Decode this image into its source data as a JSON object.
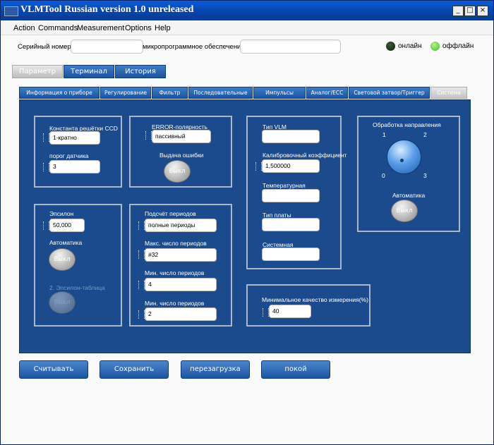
{
  "window": {
    "title": "VLMTool  Russian version 1.0 unreleased",
    "min_glyph": "_",
    "max_glyph": "□",
    "close_glyph": "×"
  },
  "menu": [
    "Action",
    "Commands",
    "Measurement",
    "Options",
    "Help"
  ],
  "topbar": {
    "serial_label": "Серийный номер",
    "serial_value": "",
    "firmware_label": "микропрограммное обеспечение",
    "firmware_value": "",
    "online_label": "онлайн",
    "offline_label": "оффлайн",
    "online_color": "#1a3a1a",
    "offline_color": "#4fd02a"
  },
  "main_tabs": [
    "Параметр",
    "Терминал",
    "История"
  ],
  "sub_tabs": [
    "Информация о приборе",
    "Регулирование",
    "Фильтр",
    "Последовательные",
    "Импульсы",
    "Аналог/ЕСС",
    "Световой затвор/Триггер",
    "Система"
  ],
  "ccd": {
    "grating_label": "Константа решётки CCD",
    "grating_value": "1-кратно",
    "threshold_label": "порог датчика",
    "threshold_value": "3"
  },
  "error": {
    "polarity_label": "ERROR-полярность",
    "polarity_value": "пассивный",
    "output_label": "Выдача ошибки",
    "output_button": "Выкл"
  },
  "vlm": {
    "type_label": "Тип VLM",
    "type_value": "",
    "calib_label": "Калибровочный коэффициент",
    "calib_value": "1,500000",
    "temp_label": "Температурная",
    "temp_value": "",
    "board_label": "Тип платы",
    "board_value": "",
    "system_label": "Системная",
    "system_value": ""
  },
  "direction": {
    "title": "Обработка направления",
    "tick1": "1",
    "tick2": "2",
    "tick0": "0",
    "tick3": "3",
    "auto_label": "Автоматика",
    "auto_button": "Выкл"
  },
  "epsilon": {
    "label": "Эпсилон",
    "value": "50,000",
    "auto_label": "Автоматика",
    "auto_button": "Выкл",
    "table_label": "2. Эпсилон-таблица",
    "table_button": "Выкл"
  },
  "periods": {
    "count_label": "Подсчёт периодов",
    "count_value": "полные периоды",
    "max_label": "Макс. число периодов",
    "max_value": "#32",
    "min1_label": "Мин. число периодов",
    "min1_value": "4",
    "min2_label": "Мин. число периодов",
    "min2_value": "2"
  },
  "quality": {
    "label": "Минимальное качество измерения(%)",
    "value": "40"
  },
  "buttons": [
    "Считывать",
    "Сохранить",
    "перезагрузка",
    "покой"
  ]
}
